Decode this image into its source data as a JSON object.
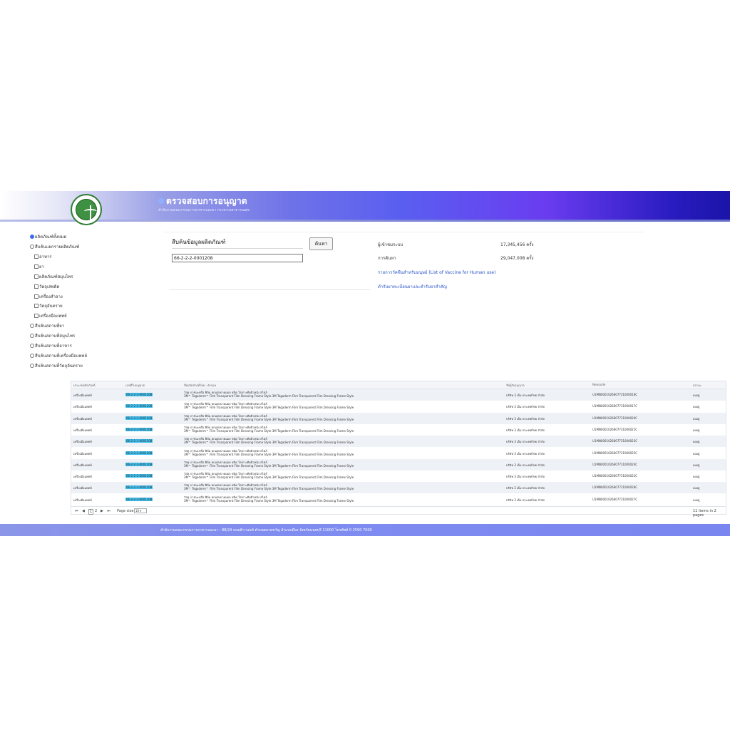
{
  "header": {
    "title": "ตรวจสอบการอนุญาต",
    "subtitle": "สำนักงานคณะกรรมการอาหารและยา กระทรวงสาธารณสุข"
  },
  "sidebar": {
    "items": [
      {
        "label": "ผลิตภัณฑ์ทั้งหมด",
        "type": "radio",
        "selected": true
      },
      {
        "label": "สืบค้นแยกรายผลิตภัณฑ์",
        "type": "radio",
        "selected": false
      },
      {
        "label": "อาหาร",
        "type": "checkbox"
      },
      {
        "label": "ยา",
        "type": "checkbox"
      },
      {
        "label": "ผลิตภัณฑ์สมุนไพร",
        "type": "checkbox"
      },
      {
        "label": "วัตถุเสพติด",
        "type": "checkbox"
      },
      {
        "label": "เครื่องสำอาง",
        "type": "checkbox"
      },
      {
        "label": "วัตถุอันตราย",
        "type": "checkbox"
      },
      {
        "label": "เครื่องมือแพทย์",
        "type": "checkbox"
      },
      {
        "label": "สืบค้นสถานที่ยา",
        "type": "radio",
        "selected": false
      },
      {
        "label": "สืบค้นสถานที่สมุนไพร",
        "type": "radio",
        "selected": false
      },
      {
        "label": "สืบค้นสถานที่อาหาร",
        "type": "radio",
        "selected": false
      },
      {
        "label": "สืบค้นสถานที่เครื่องมือแพทย์",
        "type": "radio",
        "selected": false
      },
      {
        "label": "สืบค้นสถานที่วัตถุอันตราย",
        "type": "radio",
        "selected": false
      }
    ]
  },
  "search": {
    "label": "สืบค้นข้อมูลผลิตภัณฑ์",
    "value": "66-2-2-2-0001208",
    "button": "ค้นหา"
  },
  "stats": {
    "visitors_label": "ผู้เข้าชมระบบ",
    "visitors_value": "17,345,456 ครั้ง",
    "searches_label": "การค้นหา",
    "searches_value": "29,047,008 ครั้ง",
    "link_vaccine": "รายการวัคซีนสำหรับมนุษย์ (List of Vaccine for Human use)",
    "link_drugs": "ตำรับยาทะเบียนยาและตำรับยาสำคัญ"
  },
  "table": {
    "headers": [
      "ประเภทผลิตภัณฑ์",
      "เลขที่ใบอนุญาต",
      "ชื่อผลิตภัณฑ์ไทย - อังกฤษ",
      "ชื่อผู้รับอนุญาต",
      "Newcode",
      "สถานะ"
    ],
    "rows": [
      {
        "type": "เครื่องมือแพทย์",
        "license": "66-2-2-2-0001208",
        "name_th": "วัสดุ ภาชนะหรือ ฟิล์ม ตกแต่งบาดแผล ชนิด ใสเกาะติดผิวหนัง สไตล์",
        "name_en": "3M™ Tegaderm™ Film Transparent Film Dressing Frame Style 3M Tegaderm Film Transparent Film Dressing Frame Style",
        "holder": "บริษัท 3 เอ็ม ประเทศไทย จำกัด",
        "newcode": "U1MN0001026607731000016C",
        "status": "คงอยู่"
      },
      {
        "type": "เครื่องมือแพทย์",
        "license": "66-2-2-2-0001208",
        "name_th": "วัสดุ ภาชนะหรือ ฟิล์ม ตกแต่งบาดแผล ชนิด ใสเกาะติดผิวหนัง สไตล์",
        "name_en": "3M™ Tegaderm™ Film Transparent Film Dressing Frame Style 3M Tegaderm Film Transparent Film Dressing Frame Style",
        "holder": "บริษัท 3 เอ็ม ประเทศไทย จำกัด",
        "newcode": "U1MN0001026607731000017C",
        "status": "คงอยู่"
      },
      {
        "type": "เครื่องมือแพทย์",
        "license": "66-2-2-2-0001208",
        "name_th": "วัสดุ ภาชนะหรือ ฟิล์ม ตกแต่งบาดแผล ชนิด ใสเกาะติดผิวหนัง สไตล์",
        "name_en": "3M™ Tegaderm™ Film Transparent Film Dressing Frame Style 3M Tegaderm Film Transparent Film Dressing Frame Style",
        "holder": "บริษัท 3 เอ็ม ประเทศไทย จำกัด",
        "newcode": "U1MN0001026607731000020C",
        "status": "คงอยู่"
      },
      {
        "type": "เครื่องมือแพทย์",
        "license": "66-2-2-2-0001208",
        "name_th": "วัสดุ ภาชนะหรือ ฟิล์ม ตกแต่งบาดแผล ชนิด ใสเกาะติดผิวหนัง สไตล์",
        "name_en": "3M™ Tegaderm™ Film Transparent Film Dressing Frame Style 3M Tegaderm Film Transparent Film Dressing Frame Style",
        "holder": "บริษัท 3 เอ็ม ประเทศไทย จำกัด",
        "newcode": "U1MN0001026607731000021C",
        "status": "คงอยู่"
      },
      {
        "type": "เครื่องมือแพทย์",
        "license": "66-2-2-2-0001208",
        "name_th": "วัสดุ ภาชนะหรือ ฟิล์ม ตกแต่งบาดแผล ชนิด ใสเกาะติดผิวหนัง สไตล์",
        "name_en": "3M™ Tegaderm™ Film Transparent Film Dressing Frame Style 3M Tegaderm Film Transparent Film Dressing Frame Style",
        "holder": "บริษัท 3 เอ็ม ประเทศไทย จำกัด",
        "newcode": "U1MN0001026607731000023C",
        "status": "คงอยู่"
      },
      {
        "type": "เครื่องมือแพทย์",
        "license": "66-2-2-2-0001208",
        "name_th": "วัสดุ ภาชนะหรือ ฟิล์ม ตกแต่งบาดแผล ชนิด ใสเกาะติดผิวหนัง สไตล์",
        "name_en": "3M™ Tegaderm™ Film Transparent Film Dressing Frame Style 3M Tegaderm Film Transparent Film Dressing Frame Style",
        "holder": "บริษัท 3 เอ็ม ประเทศไทย จำกัด",
        "newcode": "U1MN0001026607731000025C",
        "status": "คงอยู่"
      },
      {
        "type": "เครื่องมือแพทย์",
        "license": "66-2-2-2-0001208",
        "name_th": "วัสดุ ภาชนะหรือ ฟิล์ม ตกแต่งบาดแผล ชนิด ใสเกาะติดผิวหนัง สไตล์",
        "name_en": "3M™ Tegaderm™ Film Transparent Film Dressing Frame Style 3M Tegaderm Film Transparent Film Dressing Frame Style",
        "holder": "บริษัท 3 เอ็ม ประเทศไทย จำกัด",
        "newcode": "U1MN0001026607731000024C",
        "status": "คงอยู่"
      },
      {
        "type": "เครื่องมือแพทย์",
        "license": "66-2-2-2-0001208",
        "name_th": "วัสดุ ภาชนะหรือ ฟิล์ม ตกแต่งบาดแผล ชนิด ใสเกาะติดผิวหนัง สไตล์",
        "name_en": "3M™ Tegaderm™ Film Transparent Film Dressing Frame Style 3M Tegaderm Film Transparent Film Dressing Frame Style",
        "holder": "บริษัท 3 เอ็ม ประเทศไทย จำกัด",
        "newcode": "U1MN0001026607731000022C",
        "status": "คงอยู่"
      },
      {
        "type": "เครื่องมือแพทย์",
        "license": "66-2-2-2-0001208",
        "name_th": "วัสดุ ภาชนะหรือ ฟิล์ม ตกแต่งบาดแผล ชนิด ใสเกาะติดผิวหนัง สไตล์",
        "name_en": "3M™ Tegaderm™ Film Transparent Film Dressing Frame Style 3M Tegaderm Film Transparent Film Dressing Frame Style",
        "holder": "บริษัท 3 เอ็ม ประเทศไทย จำกัด",
        "newcode": "U1MN0001026607731000026C",
        "status": "คงอยู่"
      },
      {
        "type": "เครื่องมือแพทย์",
        "license": "66-2-2-2-0001208",
        "name_th": "วัสดุ ภาชนะหรือ ฟิล์ม ตกแต่งบาดแผล ชนิด ใสเกาะติดผิวหนัง สไตล์",
        "name_en": "3M™ Tegaderm™ Film Transparent Film Dressing Frame Style 3M Tegaderm Film Transparent Film Dressing Frame Style",
        "holder": "บริษัท 3 เอ็ม ประเทศไทย จำกัด",
        "newcode": "U1MN0001026607731000027C",
        "status": "คงอยู่"
      }
    ]
  },
  "pager": {
    "first": "⏮",
    "prev": "◀",
    "page1": "1",
    "page2": "2",
    "next": "▶",
    "last": "⏭",
    "page_size_label": "Page size:",
    "page_size_value": "10",
    "summary": "11 items in 2 pages"
  },
  "footer": {
    "text": "สำนักงานคณะกรรมการอาหารและยา : 88/24 ถนนติวานนท์ ตำบลตลาดขวัญ อำเภอเมือง จังหวัดนนทบุรี 11000 โทรศัพท์ 0 2590 7000"
  },
  "colors": {
    "header_start": "#ffffff",
    "header_mid": "#5a5ef0",
    "header_end": "#1a14a8",
    "license_highlight": "#3ec1f0",
    "footer": "#7f8cf0",
    "link": "#2a55c8"
  }
}
